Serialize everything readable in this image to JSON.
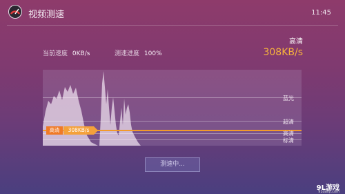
{
  "header": {
    "title": "视频测速",
    "time": "11:45",
    "icon": "speedometer-app-icon"
  },
  "stats": {
    "current_speed_label": "当前速度",
    "current_speed_value": "0KB/s",
    "progress_label": "测速进度",
    "progress_value": "100%"
  },
  "result": {
    "quality": "高清",
    "speed": "308KB/s",
    "speed_color": "#f8b33c"
  },
  "graph": {
    "tiers": [
      "蓝光",
      "超清",
      "高清",
      "标清"
    ],
    "current_quality": "高清",
    "current_speed": "308KB/s",
    "line_color": "#f29a2a"
  },
  "button": {
    "label": "测速中..."
  },
  "watermark": {
    "logo": "9L游戏",
    "domain": "91danji.com"
  }
}
